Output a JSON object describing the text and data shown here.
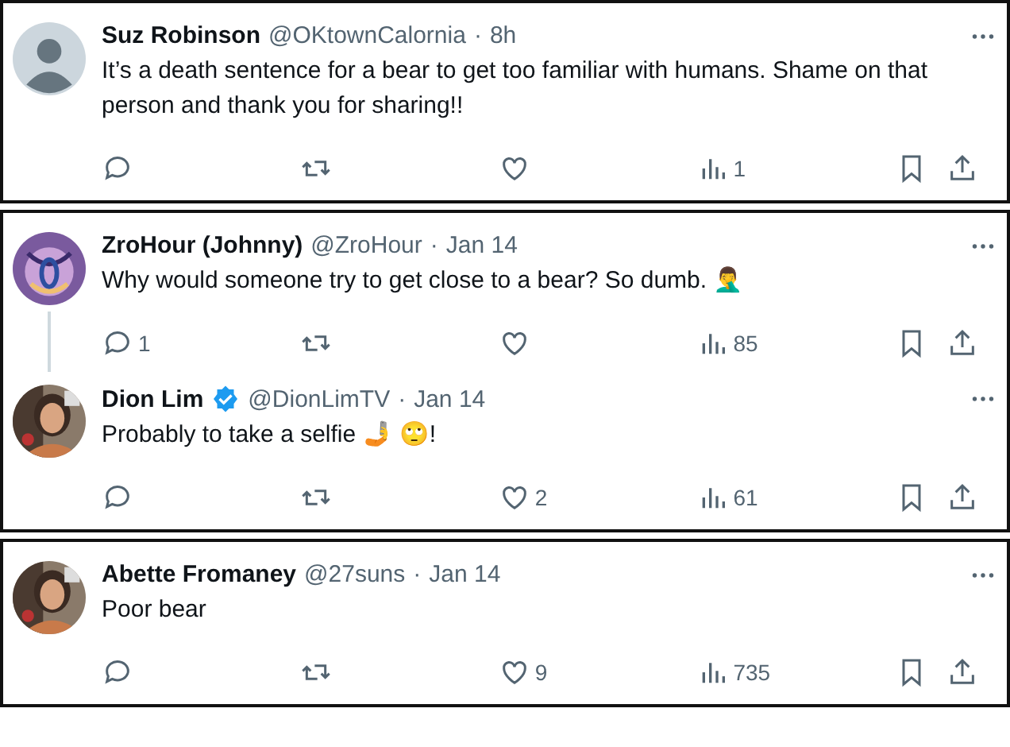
{
  "cards": [
    {
      "tweets": [
        {
          "name": "Suz Robinson",
          "verified": false,
          "handle": "@OKtownCalornia",
          "separator": "·",
          "time": "8h",
          "avatar": {
            "kind": "default"
          },
          "text": "It’s a death sentence for a bear to get too familiar with humans. Shame on that person and thank you for sharing!!",
          "views": "1"
        }
      ]
    },
    {
      "tweets": [
        {
          "name": "ZroHour (Johnny)",
          "verified": false,
          "handle": "@ZroHour",
          "separator": "·",
          "time": "Jan 14",
          "avatar": {
            "kind": "emblem"
          },
          "text": "Why would someone try to get close to a bear? So dumb. 🤦‍♂️",
          "replies": "1",
          "views": "85"
        },
        {
          "name": "Dion Lim",
          "verified": true,
          "handle": "@DionLimTV",
          "separator": "·",
          "time": "Jan 14",
          "text": "Probably to take a selfie 🤳 🙄!",
          "likes": "2",
          "views": "61"
        }
      ]
    },
    {
      "tweets": [
        {
          "name": "Abette Fromaney",
          "verified": false,
          "handle": "@27suns",
          "separator": "·",
          "time": "Jan 14",
          "text": "Poor bear",
          "likes": "9",
          "views": "735"
        }
      ]
    }
  ]
}
